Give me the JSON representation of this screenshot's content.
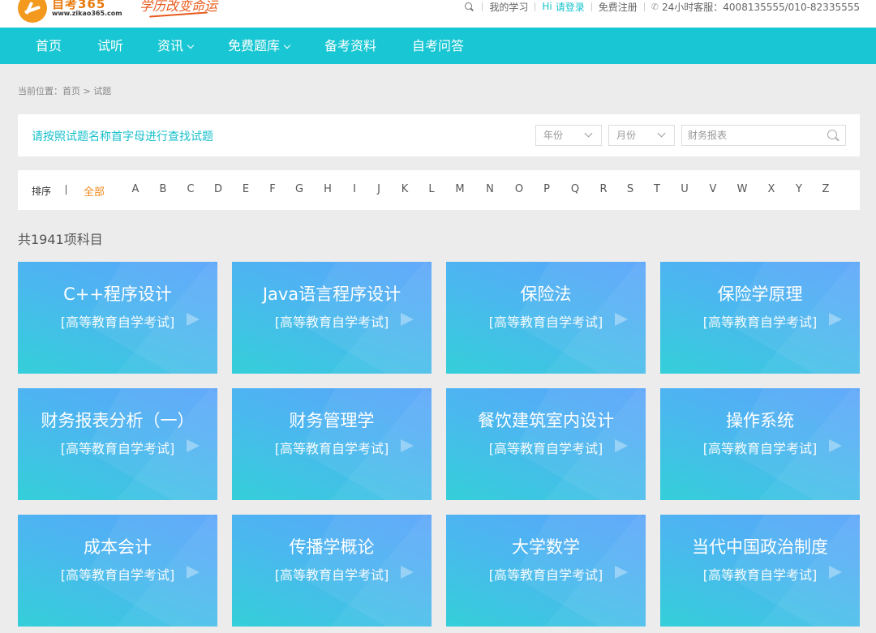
{
  "header": {
    "logo_text": "自考365",
    "logo_sub": "www.zikao365.com",
    "slogan": "学历改变命运",
    "links": {
      "my_study": "我的学习",
      "hi": "Hi",
      "login": "请登录",
      "register": "免费注册",
      "service": "24小时客服：4008135555/010-82335555"
    }
  },
  "nav": {
    "items": [
      {
        "label": "首页"
      },
      {
        "label": "试听"
      },
      {
        "label": "资讯"
      },
      {
        "label": "免费题库"
      },
      {
        "label": "备考资料"
      },
      {
        "label": "自考问答"
      }
    ]
  },
  "breadcrumb": "当前位置：首页 > 试题",
  "filter": {
    "title": "请按照试题名称首字母进行查找试题",
    "year_placeholder": "年份",
    "month_placeholder": "月份",
    "search_placeholder": "财务报表"
  },
  "letters": {
    "sort_label": "排序",
    "all_label": "全部",
    "items": [
      "A",
      "B",
      "C",
      "D",
      "E",
      "F",
      "G",
      "H",
      "I",
      "J",
      "K",
      "L",
      "M",
      "N",
      "O",
      "P",
      "Q",
      "R",
      "S",
      "T",
      "U",
      "V",
      "W",
      "X",
      "Y",
      "Z"
    ]
  },
  "count_text": "共1941项科目",
  "cards": [
    {
      "title": "C++程序设计",
      "subtitle": "[高等教育自学考试]"
    },
    {
      "title": "Java语言程序设计",
      "subtitle": "[高等教育自学考试]"
    },
    {
      "title": "保险法",
      "subtitle": "[高等教育自学考试]"
    },
    {
      "title": "保险学原理",
      "subtitle": "[高等教育自学考试]"
    },
    {
      "title": "财务报表分析（一）",
      "subtitle": "[高等教育自学考试]"
    },
    {
      "title": "财务管理学",
      "subtitle": "[高等教育自学考试]"
    },
    {
      "title": "餐饮建筑室内设计",
      "subtitle": "[高等教育自学考试]"
    },
    {
      "title": "操作系统",
      "subtitle": "[高等教育自学考试]"
    },
    {
      "title": "成本会计",
      "subtitle": "[高等教育自学考试]"
    },
    {
      "title": "传播学概论",
      "subtitle": "[高等教育自学考试]"
    },
    {
      "title": "大学数学",
      "subtitle": "[高等教育自学考试]"
    },
    {
      "title": "当代中国政治制度",
      "subtitle": "[高等教育自学考试]"
    }
  ],
  "colors": {
    "brand_cyan": "#18c7d3",
    "accent_orange": "#f08a1c",
    "card_blue": "#5aa4fb",
    "card_teal": "#34cfd9"
  }
}
